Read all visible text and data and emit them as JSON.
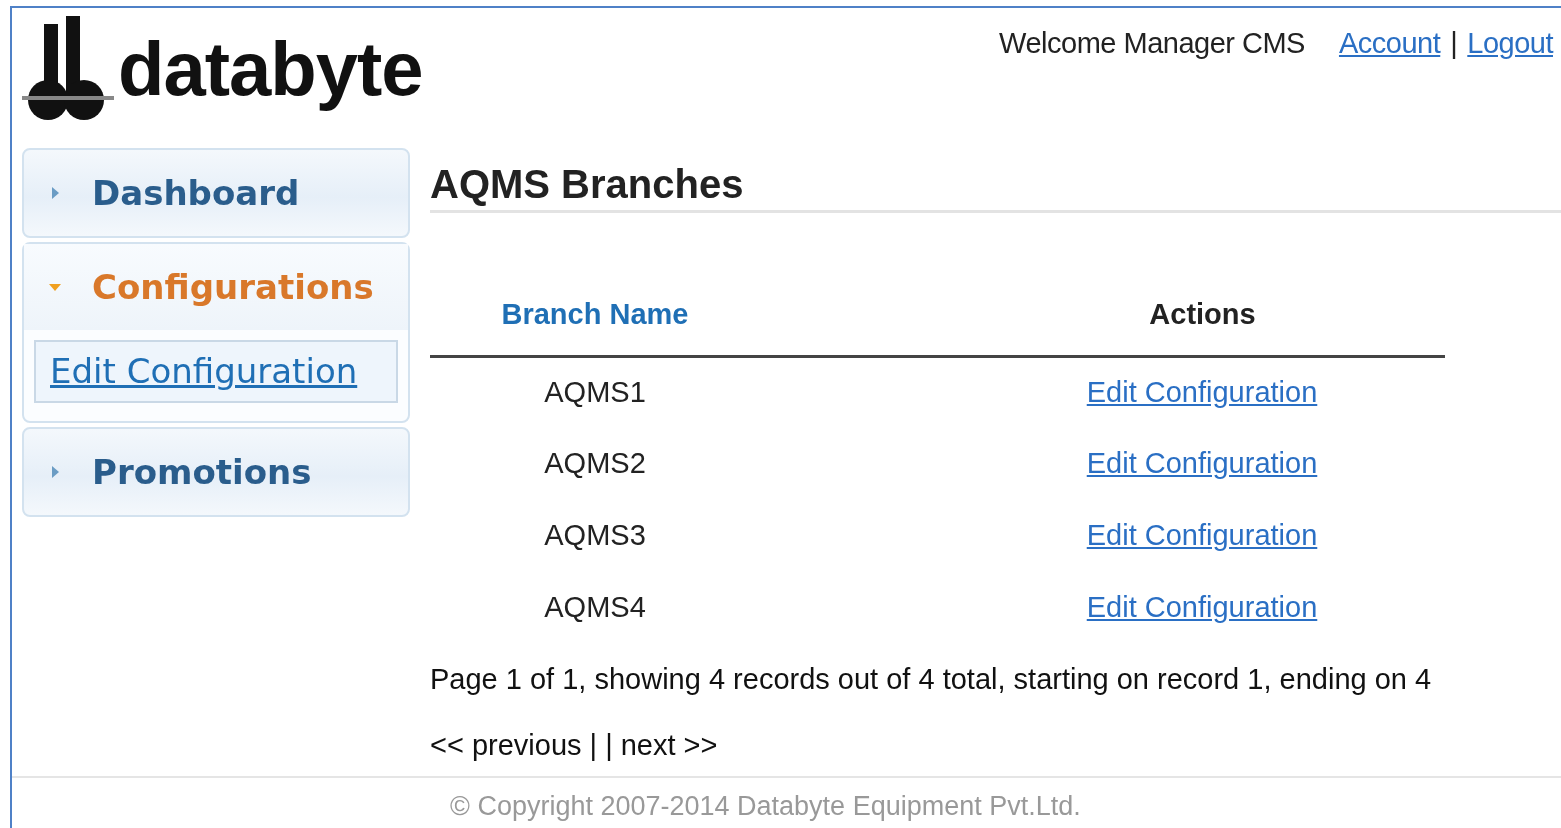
{
  "header": {
    "logo_text": "databyte",
    "welcome": "Welcome Manager CMS",
    "links": [
      {
        "label": "Account"
      },
      {
        "label": "Logout"
      }
    ],
    "link_separator": "|"
  },
  "sidebar": {
    "items": [
      {
        "label": "Dashboard",
        "expanded": false
      },
      {
        "label": "Configurations",
        "expanded": true,
        "children": [
          {
            "label": "Edit Configuration"
          }
        ]
      },
      {
        "label": "Promotions",
        "expanded": false
      }
    ]
  },
  "main": {
    "title": "AQMS Branches",
    "table": {
      "columns": [
        {
          "label": "Branch Name",
          "kind": "link"
        },
        {
          "label": "Actions",
          "kind": "plain"
        }
      ],
      "rows": [
        {
          "branch": "AQMS1",
          "action": "Edit Configuration"
        },
        {
          "branch": "AQMS2",
          "action": "Edit Configuration"
        },
        {
          "branch": "AQMS3",
          "action": "Edit Configuration"
        },
        {
          "branch": "AQMS4",
          "action": "Edit Configuration"
        }
      ]
    },
    "summary": "Page 1 of 1, showing 4 records out of 4 total, starting on record 1, ending on 4",
    "pager": {
      "previous": "<< previous",
      "separator": "| |",
      "next": "next >>"
    }
  },
  "footer": {
    "copyright": "© Copyright 2007-2014 Databyte Equipment Pvt.Ltd."
  }
}
